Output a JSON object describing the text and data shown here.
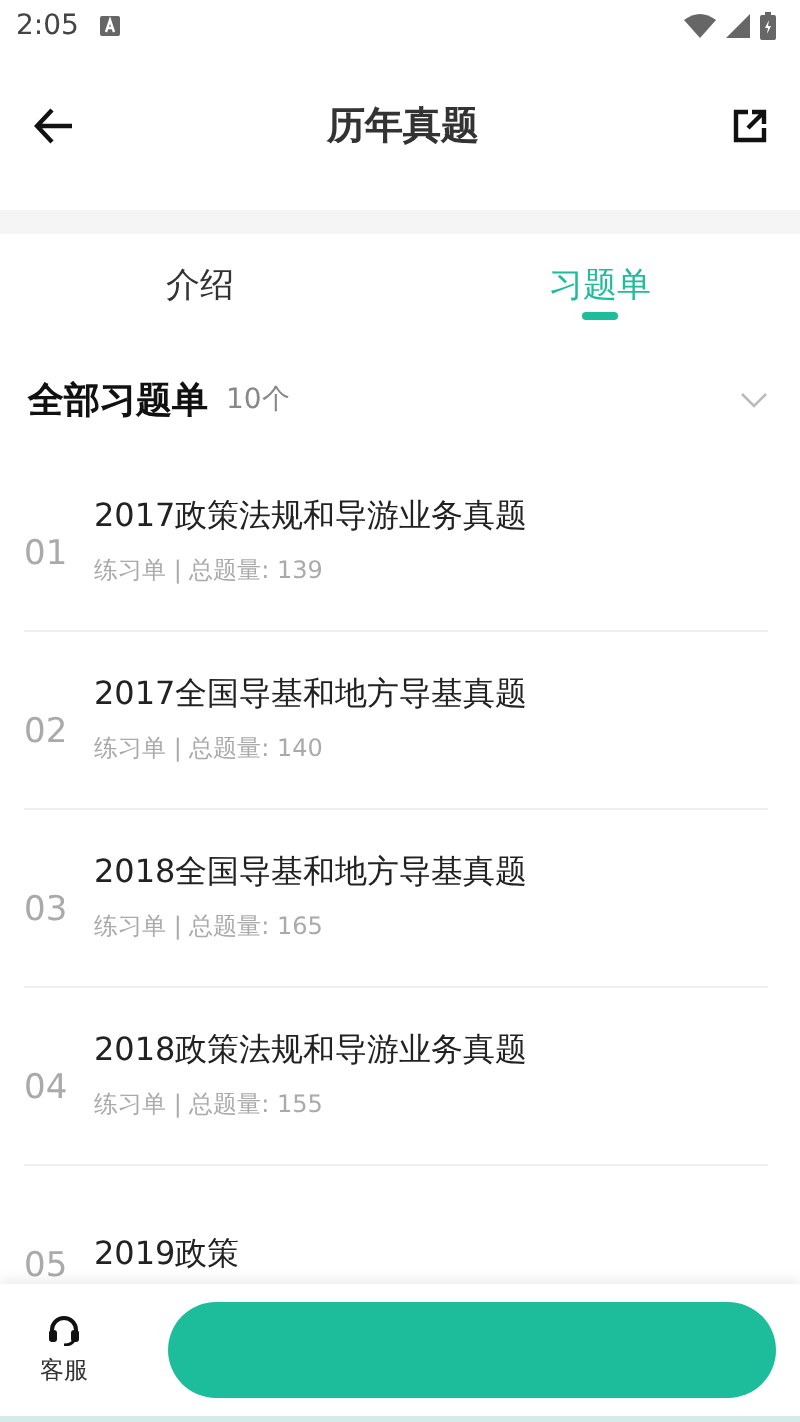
{
  "status_bar": {
    "time": "2:05"
  },
  "header": {
    "title": "历年真题"
  },
  "tabs": [
    {
      "label": "介绍",
      "selected": false
    },
    {
      "label": "习题单",
      "selected": true
    }
  ],
  "section": {
    "title": "全部习题单",
    "count": "10个",
    "expanded": false
  },
  "items": [
    {
      "number": "01",
      "title": "2017政策法规和导游业务真题",
      "meta": "练习单 | 总题量: 139"
    },
    {
      "number": "02",
      "title": "2017全国导基和地方导基真题",
      "meta": "练习单 | 总题量: 140"
    },
    {
      "number": "03",
      "title": "2018全国导基和地方导基真题",
      "meta": "练习单 | 总题量: 165"
    },
    {
      "number": "04",
      "title": "2018政策法规和导游业务真题",
      "meta": "练习单 | 总题量: 155"
    },
    {
      "number": "05",
      "title": "2019政策"
    }
  ],
  "bottom_bar": {
    "service_label": "客服"
  }
}
